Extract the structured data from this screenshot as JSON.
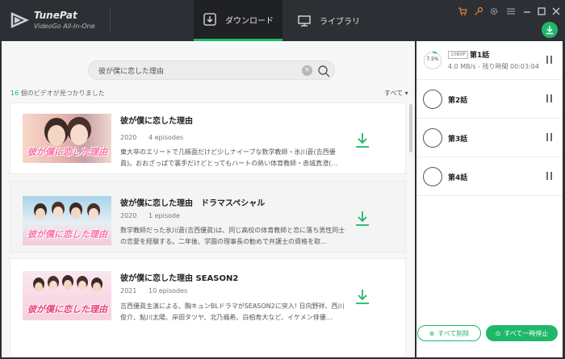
{
  "app": {
    "name": "TunePat",
    "subtitle": "VideoGo All-In-One"
  },
  "tabs": [
    {
      "label": "ダウンロード",
      "active": true
    },
    {
      "label": "ライブラリ",
      "active": false
    }
  ],
  "colors": {
    "accent": "#1fb86a",
    "titlebar": "#2c2f34"
  },
  "search": {
    "value": "彼が僕に恋した理由"
  },
  "results": {
    "count": "16",
    "label": "個のビデオが見つかりました",
    "filter": "すべて"
  },
  "videos": [
    {
      "title": "彼が僕に恋した理由",
      "year": "2020",
      "episodes": "4 episodes",
      "description": "東大卒のエリートで几帳面だけど少しナイーブな数学教師・氷川蒼(吉西優眞)。おおざっぱで裏手だけどとってもハートの熱い体育教師・赤城真澄(…",
      "thumb_text": "彼が僕に恋した理由"
    },
    {
      "title": "彼が僕に恋した理由　ドラマスペシャル",
      "year": "2020",
      "episodes": "1 episode",
      "description": "数学教師だった氷川蒼(吉西優眞)は、同じ高校の体育教師と恋に落ち男性同士の恋愛を経験する。二年後、学園の理事長の勧めで弁護士の資格を取…",
      "thumb_text": "彼が僕に恋した理由"
    },
    {
      "title": "彼が僕に恋した理由 SEASON2",
      "year": "2021",
      "episodes": "10 episodes",
      "description": "吉西優眞主演による、胸キュンBLドラマがSEASON2に突入! 日向野祥、西川俊介、鮎川太陽、岸田タツヤ、北乃颯希、白柏寿大など、イケメン俳優…",
      "thumb_text": "彼が僕に恋した理由"
    }
  ],
  "queue": {
    "items": [
      {
        "title": "第1話",
        "quality": "1080P",
        "progress": "7.5%",
        "speed": "4.0 MB/s - 残り時間 00:03:04"
      },
      {
        "title": "第2話"
      },
      {
        "title": "第3話"
      },
      {
        "title": "第4話"
      }
    ],
    "delete_all": "すべて削除",
    "pause_all": "すべて一時停止"
  }
}
